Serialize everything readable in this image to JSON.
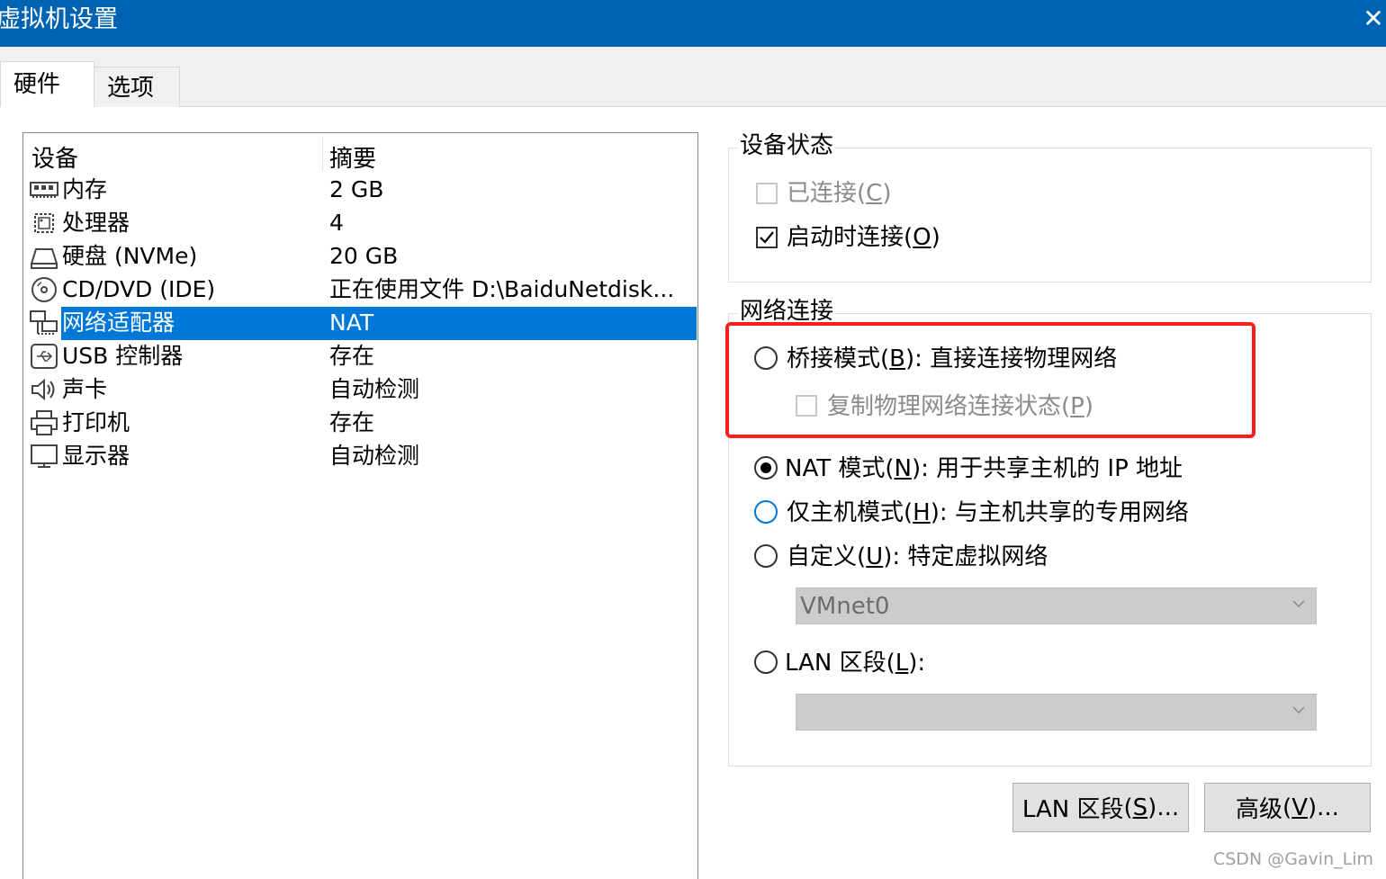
{
  "window": {
    "title": "虚拟机设置",
    "close": "✕"
  },
  "tabs": [
    {
      "label": "硬件"
    },
    {
      "label": "选项"
    }
  ],
  "devices": {
    "col_device": "设备",
    "col_summary": "摘要",
    "rows": [
      {
        "name": "内存",
        "summary": "2 GB",
        "icon": "memory-icon"
      },
      {
        "name": "处理器",
        "summary": "4",
        "icon": "cpu-icon"
      },
      {
        "name": "硬盘 (NVMe)",
        "summary": "20 GB",
        "icon": "disk-icon"
      },
      {
        "name": "CD/DVD (IDE)",
        "summary": "正在使用文件 D:\\BaiduNetdisk...",
        "icon": "cd-icon"
      },
      {
        "name": "网络适配器",
        "summary": "NAT",
        "icon": "network-icon"
      },
      {
        "name": "USB 控制器",
        "summary": "存在",
        "icon": "usb-icon"
      },
      {
        "name": "声卡",
        "summary": "自动检测",
        "icon": "speaker-icon"
      },
      {
        "name": "打印机",
        "summary": "存在",
        "icon": "printer-icon"
      },
      {
        "name": "显示器",
        "summary": "自动检测",
        "icon": "monitor-icon"
      }
    ],
    "selected_index": 4
  },
  "device_status": {
    "legend": "设备状态",
    "connected": {
      "label": "已连接",
      "key": "C",
      "checked": false,
      "enabled": false
    },
    "connect_at_power_on": {
      "label": "启动时连接",
      "key": "O",
      "checked": true,
      "enabled": true
    }
  },
  "network": {
    "legend": "网络连接",
    "bridged": {
      "label": "桥接模式",
      "key": "B",
      "desc": ": 直接连接物理网络"
    },
    "replicate": {
      "label": "复制物理网络连接状态",
      "key": "P"
    },
    "nat": {
      "label": "NAT 模式",
      "key": "N",
      "desc": ": 用于共享主机的 IP 地址"
    },
    "hostonly": {
      "label": "仅主机模式",
      "key": "H",
      "desc": ": 与主机共享的专用网络"
    },
    "custom": {
      "label": "自定义",
      "key": "U",
      "desc": ": 特定虚拟网络"
    },
    "custom_value": "VMnet0",
    "lan": {
      "label": "LAN 区段",
      "key": "L",
      "desc": ":"
    },
    "lan_value": "",
    "selected": "nat"
  },
  "buttons": {
    "lan_segments": {
      "label": "LAN 区段",
      "key": "S",
      "suffix": "..."
    },
    "advanced": {
      "label": "高级",
      "key": "V",
      "suffix": "..."
    }
  },
  "watermark": "CSDN @Gavin_Lim",
  "colors": {
    "titlebar": "#0063b1",
    "selection": "#0078d7",
    "highlight_box": "#ff1f1f"
  }
}
